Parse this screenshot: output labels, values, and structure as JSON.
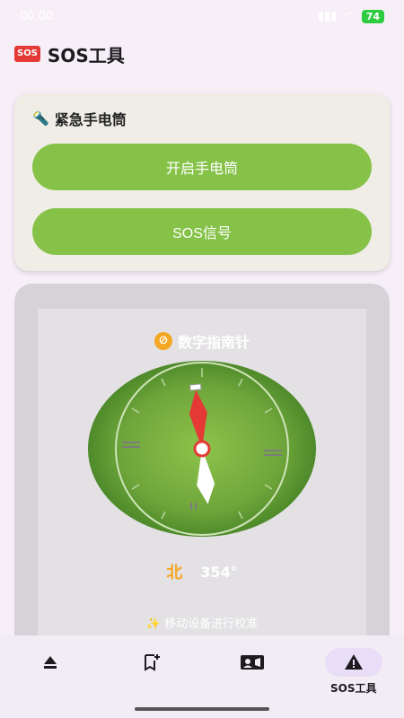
{
  "status_bar": {
    "time": "00:00",
    "battery": "74"
  },
  "app": {
    "badge": "SOS",
    "title": "SOS工具"
  },
  "flashlight_card": {
    "title": "紧急手电筒",
    "icon": "flashlight-icon",
    "buttons": [
      {
        "label": "开启手电筒"
      },
      {
        "label": "SOS信号"
      }
    ]
  },
  "compass_card": {
    "title": "数字指南针",
    "icon": "compass-icon",
    "direction": "北",
    "heading_deg": 354,
    "heading_label": "354°",
    "calibrate_hint": "✨ 移动设备进行校准"
  },
  "colors": {
    "accent": "#86c248",
    "direction": "#f5a623",
    "nav_active": "#e8def8"
  },
  "bottom_nav": {
    "items": [
      {
        "icon": "eject-icon",
        "label": ""
      },
      {
        "icon": "bookmark-add-icon",
        "label": ""
      },
      {
        "icon": "contact-card-icon",
        "label": ""
      },
      {
        "icon": "warning-icon",
        "label": "SOS工具",
        "active": true
      }
    ]
  }
}
